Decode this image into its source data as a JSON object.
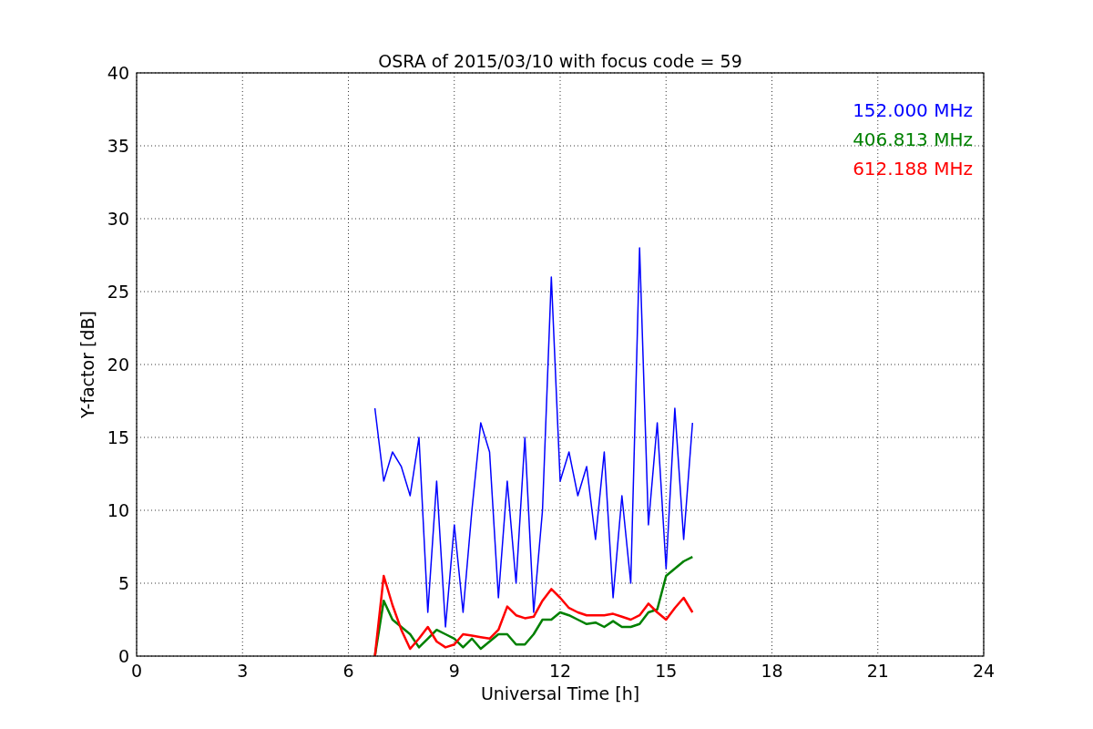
{
  "chart_data": {
    "type": "line",
    "title": "OSRA of 2015/03/10 with focus code = 59",
    "xlabel": "Universal Time [h]",
    "ylabel": "Y-factor [dB]",
    "x": [
      6.75,
      7,
      7.25,
      7.5,
      7.75,
      8,
      8.25,
      8.5,
      8.75,
      9,
      9.25,
      9.5,
      9.75,
      10,
      10.25,
      10.5,
      10.75,
      11,
      11.25,
      11.5,
      11.75,
      12,
      12.25,
      12.5,
      12.75,
      13,
      13.25,
      13.5,
      13.75,
      14,
      14.25,
      14.5,
      14.75,
      15,
      15.25,
      15.5,
      15.75
    ],
    "grid": true,
    "xlim": [
      0,
      24
    ],
    "ylim": [
      0,
      40
    ],
    "xticks": [
      0,
      3,
      6,
      9,
      12,
      15,
      18,
      21,
      24
    ],
    "yticks": [
      0,
      5,
      10,
      15,
      20,
      25,
      30,
      35,
      40
    ],
    "series": [
      {
        "name": "152.000 MHz",
        "color": "#0000ff",
        "values": [
          17,
          12,
          14,
          13,
          11,
          15,
          3,
          12,
          2,
          9,
          3,
          10,
          16,
          14,
          4,
          12,
          5,
          15,
          3,
          10,
          26,
          12,
          14,
          11,
          13,
          8,
          14,
          4,
          11,
          5,
          28,
          9,
          16,
          6,
          17,
          8,
          16
        ]
      },
      {
        "name": "406.813 MHz",
        "color": "#008000",
        "values": [
          0,
          3.8,
          2.5,
          2,
          1.5,
          0.6,
          1.2,
          1.8,
          1.5,
          1.2,
          0.6,
          1.2,
          0.5,
          1,
          1.5,
          1.5,
          0.8,
          0.8,
          1.5,
          2.5,
          2.5,
          3,
          2.8,
          2.5,
          2.2,
          2.3,
          2,
          2.4,
          2,
          2,
          2.2,
          3,
          3.2,
          5.5,
          6,
          6.5,
          6.8
        ]
      },
      {
        "name": "612.188 MHz",
        "color": "#ff0000",
        "values": [
          0,
          5.5,
          3.5,
          1.8,
          0.5,
          1.2,
          2,
          1,
          0.6,
          0.8,
          1.5,
          1.4,
          1.3,
          1.2,
          1.8,
          3.4,
          2.8,
          2.6,
          2.7,
          3.8,
          4.6,
          4,
          3.3,
          3,
          2.8,
          2.8,
          2.8,
          2.9,
          2.7,
          2.5,
          2.8,
          3.6,
          3,
          2.5,
          3.3,
          4,
          3
        ]
      }
    ]
  }
}
